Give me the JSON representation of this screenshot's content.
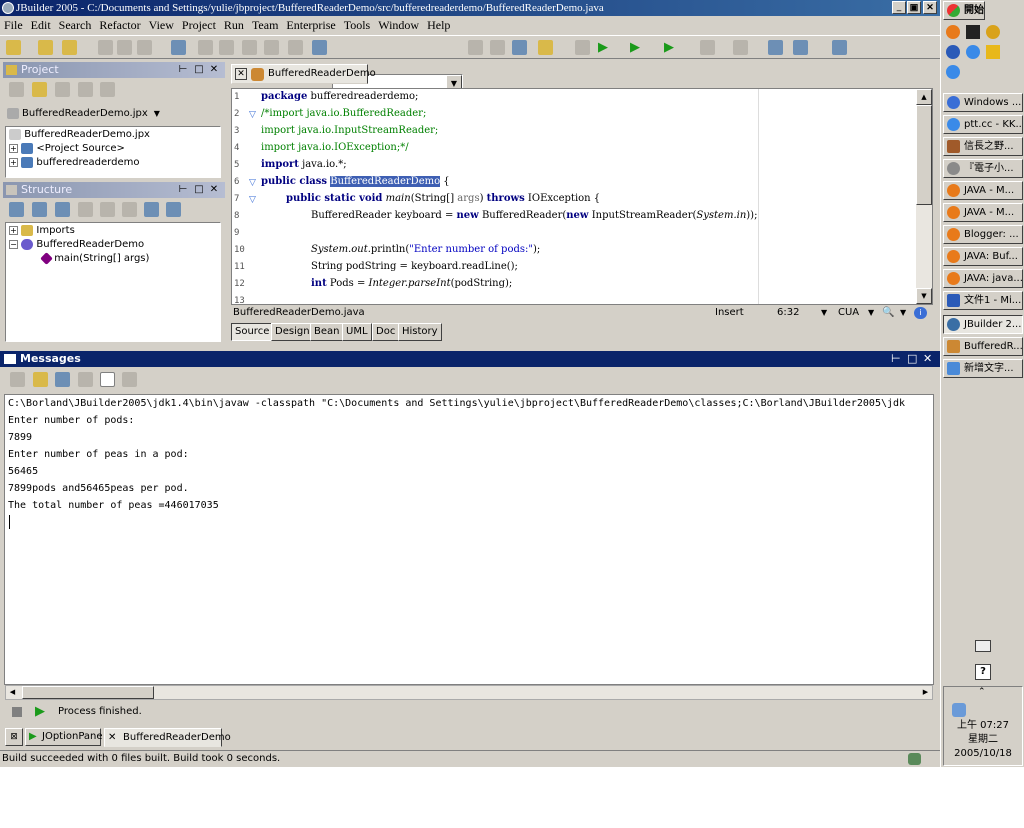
{
  "window": {
    "title": "JBuilder 2005 - C:/Documents and Settings/yulie/jbproject/BufferedReaderDemo/src/bufferedreaderdemo/BufferedReaderDemo.java",
    "min_label": "_",
    "restore_label": "▣",
    "close_label": "✕"
  },
  "menu": [
    "File",
    "Edit",
    "Search",
    "Refactor",
    "View",
    "Project",
    "Run",
    "Team",
    "Enterprise",
    "Tools",
    "Window",
    "Help"
  ],
  "project_panel": {
    "title": "Project",
    "dropdown": "BufferedReaderDemo.jpx",
    "tree": [
      "BufferedReaderDemo.jpx",
      "<Project Source>",
      "bufferedreaderdemo"
    ]
  },
  "structure_panel": {
    "title": "Structure",
    "tree": [
      "Imports",
      "BufferedReaderDemo",
      "main(String[] args)"
    ]
  },
  "editor": {
    "tab": "BufferedReaderDemo",
    "file_status": "BufferedReaderDemo.java",
    "insert_mode": "Insert",
    "position": "6:32",
    "keymap": "CUA",
    "line_numbers": [
      "1",
      "2",
      "3",
      "4",
      "5",
      "6",
      "7",
      "8",
      "9",
      "10",
      "11",
      "12",
      "13"
    ],
    "code": {
      "l1_kw": "package",
      "l1_rest": " bufferedreaderdemo;",
      "l2": "/*import java.io.BufferedReader;",
      "l3": "import java.io.InputStreamReader;",
      "l4": "import java.io.IOException;*/",
      "l5_kw": "import",
      "l5_rest": " java.io.*;",
      "l6_kw": "public class",
      "l6_sel": "BufferedReaderDemo",
      "l6_rest": " {",
      "l7_kw": "public static void",
      "l7_main": "main",
      "l7_a": "(String[]",
      "l7_args": "args",
      "l7_b": ")",
      "l7_throws": "throws",
      "l7_c": " IOException {",
      "l8_a": "BufferedReader keyboard = ",
      "l8_new": "new",
      "l8_b": " BufferedReader(",
      "l8_new2": "new",
      "l8_c": " InputStreamReader(",
      "l8_sys": "System.in",
      "l8_d": "));",
      "l10_sys": "System.out",
      "l10_a": ".println(",
      "l10_str": "\"Enter number of pods:\"",
      "l10_b": ");",
      "l11": "String podString = keyboard.readLine();",
      "l12_int": "int",
      "l12_a": " Pods = ",
      "l12_parse": "Integer.parseInt",
      "l12_b": "(podString);"
    },
    "sub_tabs": [
      "Source",
      "Design",
      "Bean",
      "UML",
      "Doc",
      "History"
    ]
  },
  "messages": {
    "title": "Messages",
    "lines": [
      "C:\\Borland\\JBuilder2005\\jdk1.4\\bin\\javaw -classpath \"C:\\Documents and Settings\\yulie\\jbproject\\BufferedReaderDemo\\classes;C:\\Borland\\JBuilder2005\\jdk",
      "Enter number of pods:",
      "7899",
      "Enter number of peas in a pod:",
      "56465",
      "7899pods and56465peas per pod.",
      "The total number of peas =446017035"
    ],
    "process_status": "Process finished.",
    "tabs": [
      "JOptionPane",
      "BufferedReaderDemo"
    ]
  },
  "status_bar": "Build succeeded with 0 files built.  Build took 0 seconds.",
  "taskbar": {
    "start": "開始",
    "items": [
      "Windows ...",
      "ptt.cc - KK...",
      "信長之野...",
      "『電子小...",
      "JAVA - M...",
      "JAVA - M...",
      "Blogger: ...",
      "JAVA: Buf...",
      "JAVA: java...",
      "文件1 - Mi...",
      "JBuilder 2...",
      "BufferedR...",
      "新增文字..."
    ],
    "clock_time": "上午 07:27",
    "clock_day": "星期二",
    "clock_date": "2005/10/18"
  }
}
